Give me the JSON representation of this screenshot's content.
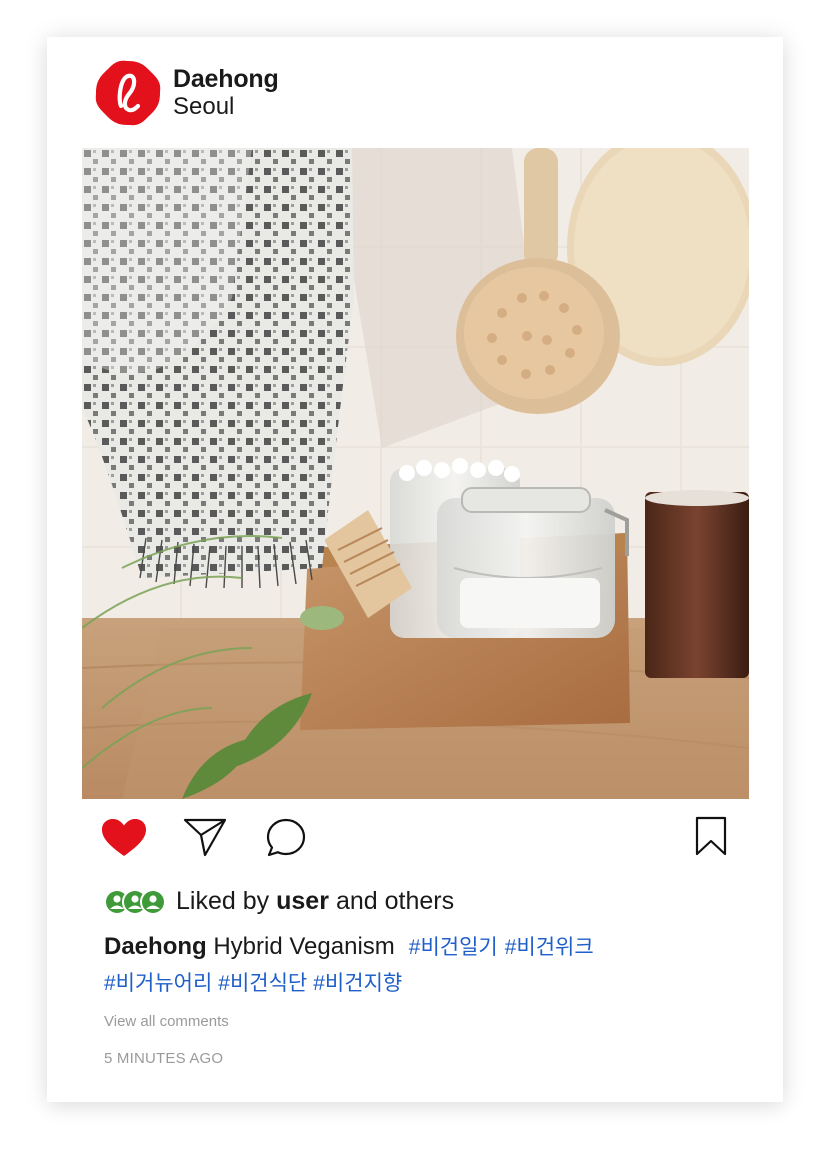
{
  "account": {
    "name": "Daehong",
    "location": "Seoul"
  },
  "colors": {
    "brand": "#e2111b",
    "like": "#e2111b",
    "hashtag": "#1f5fc9",
    "muted": "#9a9a9a",
    "liker_avatar": "#3f9a3a"
  },
  "icons": [
    "heart-icon",
    "send-icon",
    "comment-icon",
    "bookmark-icon"
  ],
  "likes": {
    "prefix": "Liked by",
    "user": "user",
    "suffix": "and others"
  },
  "caption": {
    "author": "Daehong",
    "text": "Hybrid Veganism",
    "hashtags": [
      "#비건일기",
      "#비건위크",
      "#비거뉴어리",
      "#비건식단",
      "#비건지향"
    ]
  },
  "comments_link": "View all comments",
  "timestamp": "5 MINUTES AGO"
}
